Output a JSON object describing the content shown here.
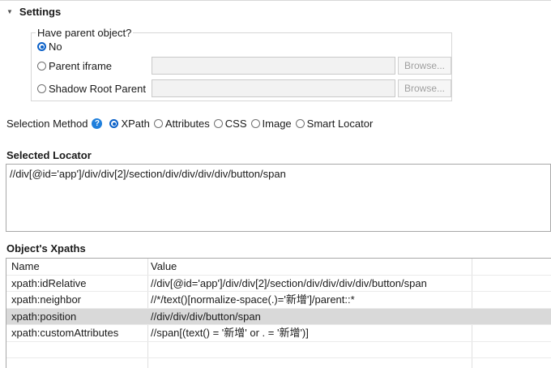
{
  "settings": {
    "title": "Settings"
  },
  "parent": {
    "legend": "Have parent object?",
    "options": [
      {
        "label": "No",
        "checked": true
      },
      {
        "label": "Parent iframe",
        "checked": false,
        "browse": "Browse..."
      },
      {
        "label": "Shadow Root Parent",
        "checked": false,
        "browse": "Browse..."
      }
    ]
  },
  "selection": {
    "label": "Selection Method",
    "help_icon": "question-circle-icon",
    "methods": [
      {
        "label": "XPath",
        "checked": true
      },
      {
        "label": "Attributes",
        "checked": false
      },
      {
        "label": "CSS",
        "checked": false
      },
      {
        "label": "Image",
        "checked": false
      },
      {
        "label": "Smart Locator",
        "checked": false
      }
    ]
  },
  "locator": {
    "title": "Selected Locator",
    "value": "//div[@id='app']/div/div[2]/section/div/div/div/div/button/span"
  },
  "xpaths": {
    "title": "Object's Xpaths",
    "columns": [
      "Name",
      "Value"
    ],
    "rows": [
      {
        "name": "xpath:idRelative",
        "value": "//div[@id='app']/div/div[2]/section/div/div/div/div/button/span"
      },
      {
        "name": "xpath:neighbor",
        "value": "//*/text()[normalize-space(.)='新增']/parent::*"
      },
      {
        "name": "xpath:position",
        "value": "//div/div/div/button/span",
        "selected": true
      },
      {
        "name": "xpath:customAttributes",
        "value": "//span[(text() = '新增' or . = '新增')]"
      }
    ]
  },
  "colors": {
    "accent": "#0a60c8",
    "help": "#1f7fdc",
    "selected_row": "#d9d9d9"
  }
}
